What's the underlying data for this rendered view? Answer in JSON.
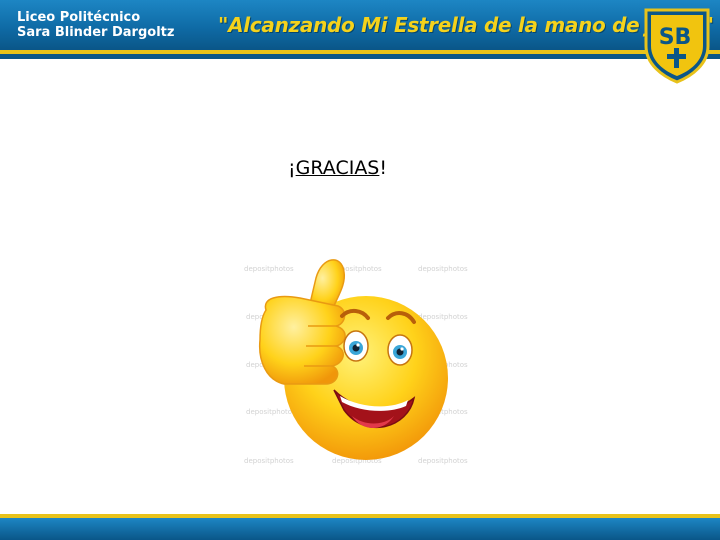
{
  "header": {
    "school_line1": "Liceo Politécnico",
    "school_line2": "Sara Blinder Dargoltz",
    "motto": "\"Alcanzando Mi Estrella de la mano de Jesús\"",
    "emblem_letters": "SB"
  },
  "slide": {
    "title_prefix": "¡",
    "title_word": "GRACIAS",
    "title_suffix": "!"
  },
  "illustration": {
    "subject": "thumbs-up-smiley",
    "watermark_text": "depositphotos"
  },
  "colors": {
    "header_blue": "#0f6ba6",
    "accent_gold": "#e8c21a",
    "motto_yellow": "#f4d21c",
    "smiley_yellow": "#ffd21a"
  }
}
